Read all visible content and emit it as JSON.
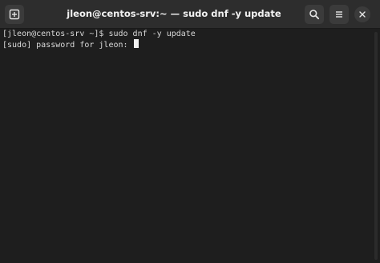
{
  "window": {
    "title": "jleon@centos-srv:~ — sudo dnf -y update"
  },
  "toolbar": {
    "new_tab_icon": "new-tab-icon",
    "search_icon": "search-icon",
    "menu_icon": "hamburger-menu-icon",
    "close_icon": "close-icon"
  },
  "terminal": {
    "lines": [
      "[jleon@centos-srv ~]$ sudo dnf -y update",
      "[sudo] password for jleon: "
    ]
  },
  "colors": {
    "background": "#1e1e1e",
    "titlebar": "#2d2d2d",
    "text": "#d9d9d9"
  }
}
